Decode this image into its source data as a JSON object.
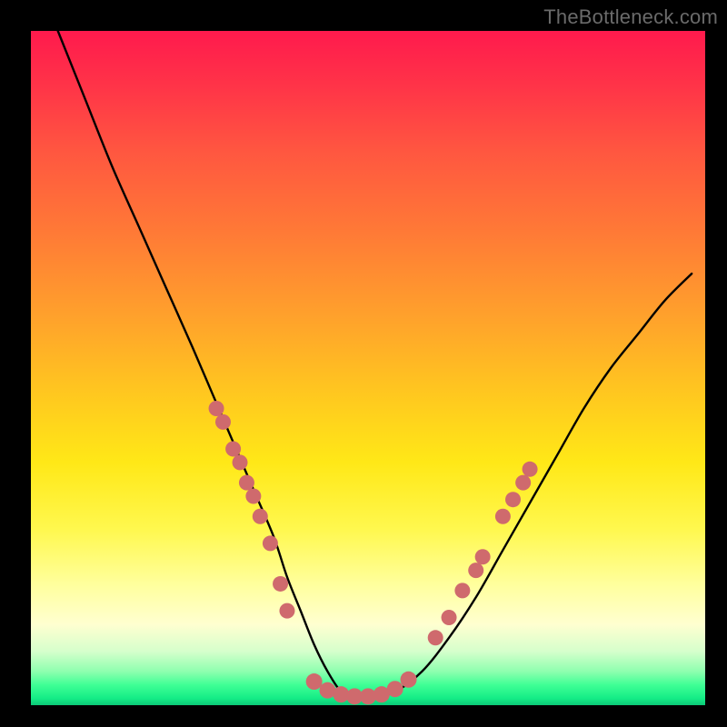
{
  "watermark": "TheBottleneck.com",
  "colors": {
    "background": "#000000",
    "curve": "#000000",
    "marker_fill": "#cf6a6d",
    "marker_stroke": "#cf6a6d"
  },
  "chart_data": {
    "type": "line",
    "title": "",
    "xlabel": "",
    "ylabel": "",
    "xlim": [
      0,
      100
    ],
    "ylim": [
      0,
      100
    ],
    "grid": false,
    "legend": false,
    "series": [
      {
        "name": "bottleneck-curve",
        "x": [
          4,
          8,
          12,
          16,
          20,
          24,
          27,
          30,
          33,
          36,
          38,
          40,
          42,
          44,
          46,
          48,
          50,
          54,
          58,
          62,
          66,
          70,
          74,
          78,
          82,
          86,
          90,
          94,
          98
        ],
        "y": [
          100,
          90,
          80,
          71,
          62,
          53,
          46,
          39,
          32,
          25,
          19,
          14,
          9,
          5,
          2,
          1,
          1,
          2,
          5,
          10,
          16,
          23,
          30,
          37,
          44,
          50,
          55,
          60,
          64
        ]
      }
    ],
    "markers": {
      "left_cluster": {
        "x": [
          27.5,
          28.5,
          30.0,
          31.0,
          32.0,
          33.0,
          34.0,
          35.5,
          37.0,
          38.0
        ],
        "y": [
          44,
          42,
          38,
          36,
          33,
          31,
          28,
          24,
          18,
          14
        ]
      },
      "bottom_cluster": {
        "x": [
          42,
          44,
          46,
          48,
          50,
          52,
          54,
          56
        ],
        "y": [
          3.5,
          2.2,
          1.6,
          1.3,
          1.3,
          1.6,
          2.4,
          3.8
        ]
      },
      "right_cluster": {
        "x": [
          60,
          62,
          64,
          66,
          67,
          70,
          71.5,
          73,
          74
        ],
        "y": [
          10,
          13,
          17,
          20,
          22,
          28,
          30.5,
          33,
          35
        ]
      }
    }
  }
}
